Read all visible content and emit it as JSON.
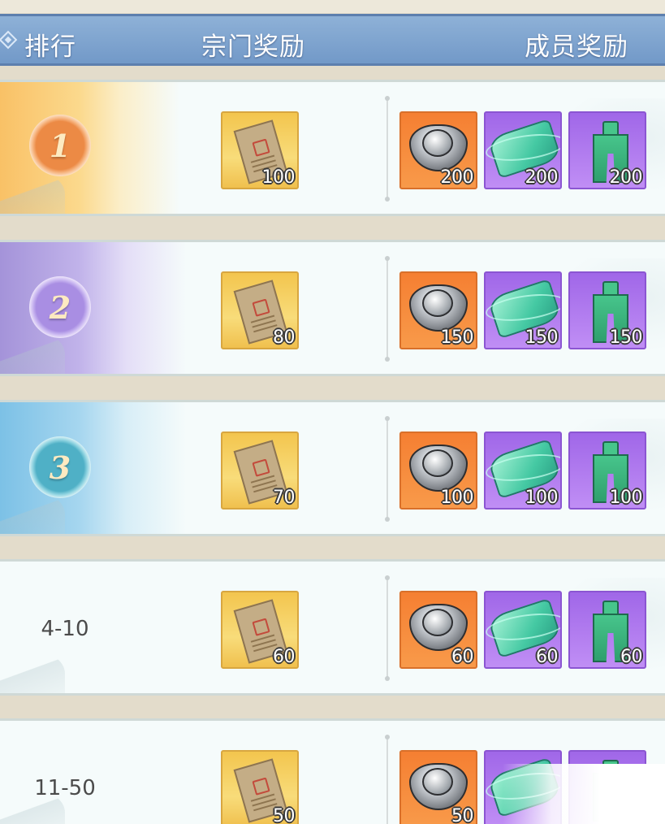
{
  "header": {
    "rank_label": "排行",
    "sect_reward_label": "宗门奖励",
    "member_reward_label": "成员奖励"
  },
  "rows": [
    {
      "rank": "1",
      "medal_color": "#ec8a45",
      "sect_reward": {
        "icon": "decree-paper-icon",
        "count": "100"
      },
      "member_rewards": [
        {
          "icon": "silver-ingot-icon",
          "count": "200"
        },
        {
          "icon": "jade-scroll-icon",
          "count": "200"
        },
        {
          "icon": "jade-figure-icon",
          "count": "200"
        }
      ]
    },
    {
      "rank": "2",
      "medal_color": "#a98ee3",
      "sect_reward": {
        "icon": "decree-paper-icon",
        "count": "80"
      },
      "member_rewards": [
        {
          "icon": "silver-ingot-icon",
          "count": "150"
        },
        {
          "icon": "jade-scroll-icon",
          "count": "150"
        },
        {
          "icon": "jade-figure-icon",
          "count": "150"
        }
      ]
    },
    {
      "rank": "3",
      "medal_color": "#4fb0c6",
      "sect_reward": {
        "icon": "decree-paper-icon",
        "count": "70"
      },
      "member_rewards": [
        {
          "icon": "silver-ingot-icon",
          "count": "100"
        },
        {
          "icon": "jade-scroll-icon",
          "count": "100"
        },
        {
          "icon": "jade-figure-icon",
          "count": "100"
        }
      ]
    },
    {
      "rank": "4-10",
      "sect_reward": {
        "icon": "decree-paper-icon",
        "count": "60"
      },
      "member_rewards": [
        {
          "icon": "silver-ingot-icon",
          "count": "60"
        },
        {
          "icon": "jade-scroll-icon",
          "count": "60"
        },
        {
          "icon": "jade-figure-icon",
          "count": "60"
        }
      ]
    },
    {
      "rank": "11-50",
      "sect_reward": {
        "icon": "decree-paper-icon",
        "count": "50"
      },
      "member_rewards": [
        {
          "icon": "silver-ingot-icon",
          "count": "50"
        },
        {
          "icon": "jade-scroll-icon",
          "count": ""
        },
        {
          "icon": "jade-figure-icon",
          "count": ""
        }
      ]
    }
  ]
}
